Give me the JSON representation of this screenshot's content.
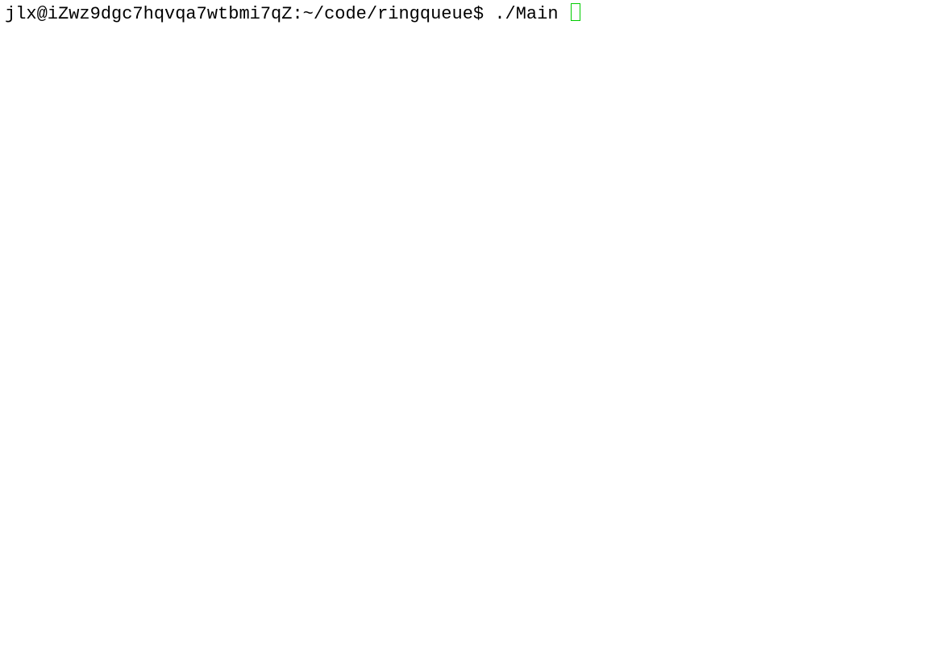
{
  "terminal": {
    "prompt": "jlx@iZwz9dgc7hqvqa7wtbmi7qZ:~/code/ringqueue$ ",
    "command": "./Main "
  }
}
